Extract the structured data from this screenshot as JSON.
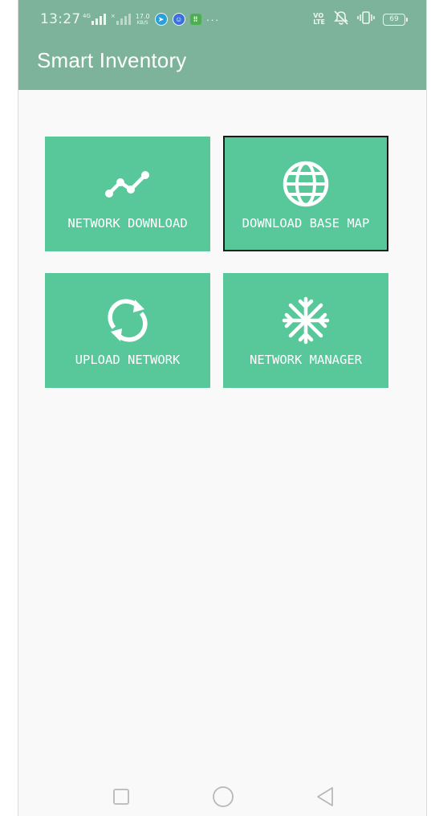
{
  "status_bar": {
    "time": "13:27",
    "net_left": "4G",
    "net_right": "×",
    "speed_value": "17.0",
    "speed_unit": "KB/S",
    "volte_top": "VO",
    "volte_bottom": "LTE",
    "battery": "69",
    "dots": "···"
  },
  "app_bar": {
    "title": "Smart Inventory",
    "background": "#7db39b"
  },
  "tiles": [
    {
      "label": "NETWORK DOWNLOAD",
      "icon": "line-chart-icon",
      "selected": false
    },
    {
      "label": "DOWNLOAD BASE MAP",
      "icon": "globe-icon",
      "selected": true
    },
    {
      "label": "UPLOAD NETWORK",
      "icon": "sync-icon",
      "selected": false
    },
    {
      "label": "NETWORK MANAGER",
      "icon": "snowflake-icon",
      "selected": false
    }
  ],
  "colors": {
    "tile": "#58c89b",
    "page": "#f9f9f9",
    "selected_border": "#1a1a1a"
  },
  "nav_bar": {
    "buttons": [
      "recents-button",
      "home-button",
      "back-button"
    ]
  }
}
